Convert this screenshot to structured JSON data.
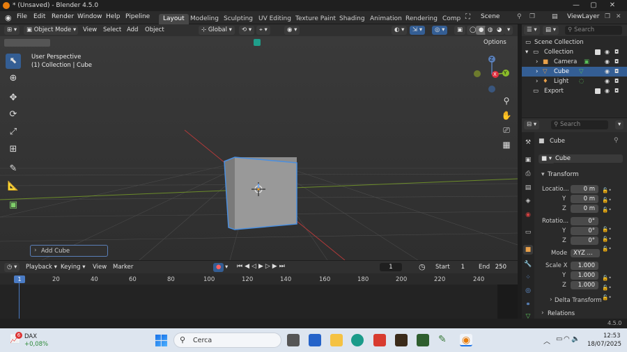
{
  "window": {
    "title": "* (Unsaved) - Blender 4.5.0"
  },
  "menus": [
    "File",
    "Edit",
    "Render",
    "Window",
    "Help",
    "Pipeline"
  ],
  "workspaces": [
    "Layout",
    "Modeling",
    "Sculpting",
    "UV Editing",
    "Texture Paint",
    "Shading",
    "Animation",
    "Rendering",
    "Comp"
  ],
  "scene": "Scene",
  "view_layer": "ViewLayer",
  "viewport_header": {
    "mode": "Object Mode",
    "menus": [
      "View",
      "Select",
      "Add",
      "Object"
    ],
    "orientation": "Global",
    "options": "Options"
  },
  "viewport": {
    "perspective": "User Perspective",
    "context": "(1) Collection | Cube",
    "last_op": "Add Cube"
  },
  "gizmo": {
    "z": "Z",
    "y": "Y",
    "x": "X"
  },
  "outliner": {
    "search_placeholder": "Search",
    "items": [
      {
        "label": "Scene Collection"
      },
      {
        "label": "Collection"
      },
      {
        "label": "Camera"
      },
      {
        "label": "Cube"
      },
      {
        "label": "Light"
      },
      {
        "label": "Export"
      }
    ]
  },
  "properties": {
    "search_placeholder": "Search",
    "object": "Cube",
    "object_field": "Cube",
    "transform_header": "Transform",
    "location_label": "Locatio...",
    "location": [
      "0 m",
      "0 m",
      "0 m"
    ],
    "rotation_label": "Rotatio...",
    "rotation": [
      "0°",
      "0°",
      "0°"
    ],
    "mode_label": "Mode",
    "mode_value": "XYZ ...",
    "scale_label": "Scale X",
    "scale": [
      "1.000",
      "1.000",
      "1.000"
    ],
    "axis_y": "Y",
    "axis_z": "Z",
    "delta": "Delta Transform",
    "relations": "Relations"
  },
  "timeline": {
    "menus": [
      "Playback",
      "Keying",
      "View",
      "Marker"
    ],
    "current_frame": "1",
    "start_label": "Start",
    "start": "1",
    "end_label": "End",
    "end": "250",
    "frame_marker": "1",
    "ticks": [
      "20",
      "40",
      "60",
      "80",
      "100",
      "120",
      "140",
      "160",
      "180",
      "200",
      "220",
      "240"
    ]
  },
  "statusbar": {
    "version": "4.5.0"
  },
  "taskbar": {
    "widget_name": "DAX",
    "widget_change": "+0,08%",
    "widget_badge": "6",
    "search": "Cerca",
    "time": "12:53",
    "date": "18/07/2025"
  },
  "colors": {
    "accent": "#345e94",
    "header": "#303030",
    "viewport": "#3c3c3c",
    "selection_outline": "#4a8fe0"
  }
}
